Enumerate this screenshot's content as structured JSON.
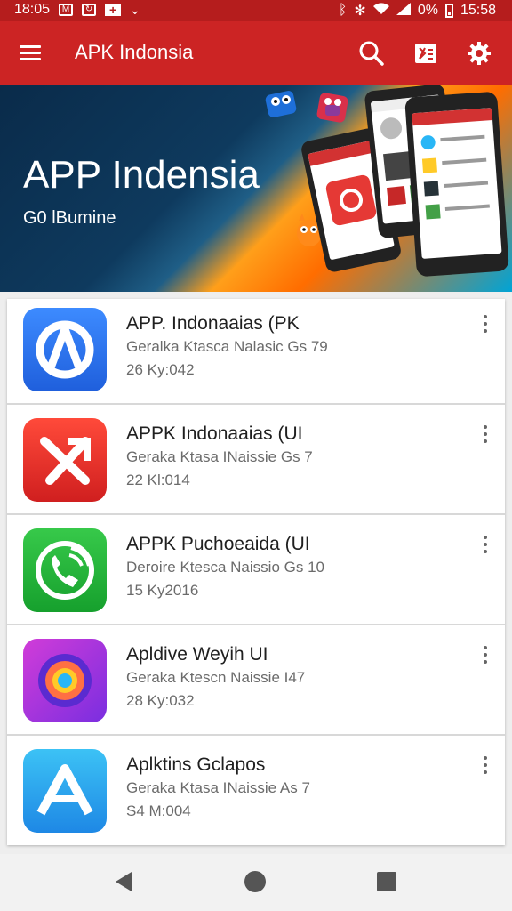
{
  "status_bar": {
    "time_left": "18:05",
    "battery": "0%",
    "time_right": "15:58"
  },
  "app_bar": {
    "title": "APK Indonsia"
  },
  "banner": {
    "title": "APP Indensia",
    "subtitle": "G0 lBumine"
  },
  "apps": [
    {
      "name": "APP. Indonaaias (PK",
      "desc": "Geralka Ktasca Nalasic Gs 79",
      "meta": "26 Ky:042",
      "icon": "chrome-like-blue-icon"
    },
    {
      "name": "APPK Indonaaias (UI",
      "desc": "Geraka Ktasa INaissie Gs 7",
      "meta": "22 Kl:014",
      "icon": "red-slash-icon"
    },
    {
      "name": "APPK Puchoeaida (UI",
      "desc": "Deroire Ktesca Naissio Gs 10",
      "meta": "15 Ky2016",
      "icon": "green-phone-icon"
    },
    {
      "name": "Apldive Weyih UI",
      "desc": "Geraka Ktescn Naissie I47",
      "meta": "28 Ky:032",
      "icon": "purple-swirl-icon"
    },
    {
      "name": "Aplktins Gclapos",
      "desc": "Geraka Ktasa INaissie As 7",
      "meta": "S4 M:004",
      "icon": "blue-a-icon"
    }
  ],
  "colors": {
    "status_bar": "#b51d1d",
    "app_bar": "#cc2424",
    "banner_dark": "#0e3a5e",
    "banner_orange": "#ff8c00"
  }
}
